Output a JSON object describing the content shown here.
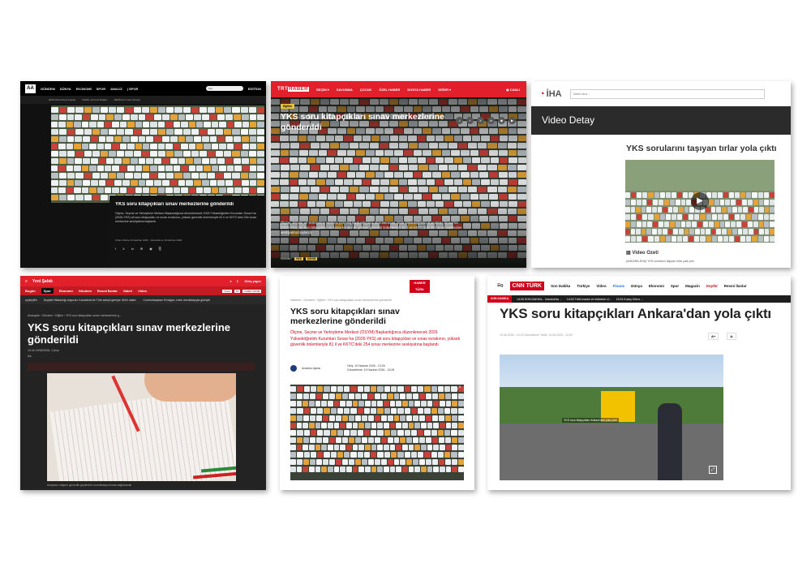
{
  "aa": {
    "logo": "AA",
    "nav": [
      "GÜNDEM",
      "DÜNYA",
      "EKONOMİ",
      "SPOR",
      "ANALİZ"
    ],
    "section": "| SPOR",
    "search_placeholder": "Ara",
    "edition": "EDİTİON",
    "ticker": [
      "2026 FIFA Dünya Kupası",
      "İSRAİL-Hürmüz Boğazı",
      "ABD/İran'ın Geri Sürüşü"
    ],
    "title": "YKS soru kitapçıkları sınav merkezlerine gönderildi",
    "summary": "Ölçme, Seçme ve Yerleştirme Merkezi Başkanlığınca düzenlenecek 2026 Yükseköğretim Kurumları Sınavı'na (2026-YKS) ait soru kitapçıkları ve sınav evrakının, yüksek güvenlik önlemleriyle 81 il ve KKTC'deki 254 sınav merkezine sevkiyatına başlandı.",
    "meta": "Ozlem Mente  19 Haziran 2026 · Güncelleme 19 Haziran 2026",
    "social": [
      "f",
      "X",
      "in",
      "✉",
      "◉",
      "⎘"
    ]
  },
  "trt": {
    "brand_a": "TRT",
    "brand_b": "HABER",
    "nav": [
      "SEÇİM ▾",
      "SAVUNMA",
      "ÇOCUK",
      "ÖZEL HABER",
      "DOSYA HABER",
      "DİĞER ▾"
    ],
    "live": "◉ CANLI",
    "tag": "Eğitim",
    "title": "YKS soru kitapçıkları sınav merkezlerine gönderildi",
    "social": [
      "♫",
      "f",
      "X",
      "in",
      "◉",
      "▶"
    ],
    "summary": "Ölçme, Seçme ve Yerleştirme Merkezi (ÖSYM) Başkanlığınca düzenlenecek 2026 Yükseköğretim Kurumları Sınavı'na (2026-YKS) ait soru kitapçıkları ve sınav evrakının, yüksek güvenlik önlemleriyle 81 il ve KKTC'deki 254 sınav merkezine sevkiyatına başlandı.",
    "tags_label": "Etiketler:",
    "tags": [
      "YKS",
      "ÖSYM"
    ]
  },
  "iha": {
    "logo_letter": "İHA",
    "video_search_placeholder": "Video Ara ...",
    "bar_title": "Video Detay",
    "title": "YKS sorularını taşıyan tırlar yola çıktı",
    "play": "▶",
    "summary_heading": "Video Özeti",
    "summary": "(ANKARA-DHA) YKS sorularını taşıyan tırlar yola çıktı"
  },
  "ys": {
    "logo": "Yeni Şafak",
    "header_right": [
      "⌕",
      "☾",
      "Giriş yapın"
    ],
    "nav": [
      "Bugün",
      "Spor",
      "Ekonomi",
      "Gündem",
      "Resmi İlanlar",
      "Galeri",
      "Video"
    ],
    "nav_active": 1,
    "nav_right": [
      "Yerel",
      "TV",
      "CANLI YAYIN"
    ],
    "ticker": [
      "çeyleyBN",
      "Dışişleri Bakanlığı duyurdu: Karadeniz'de Türk sahipli gemiye İHA'lı saldırı",
      "Cumhurbaşkanı Erdoğan, İranlı mevkidaşıyla görüştü"
    ],
    "breadcrumb": "Anasayfa  ›  Gündem  ›  Eğitim  ›  YKS soru kitapçıkları sınav merkezlerine g...",
    "title": "YKS soru kitapçıkları sınav merkezlerine gönderildi",
    "date": "10:44   19/06/2026, Cuma",
    "source": "AA",
    "image_caption": "Araçların ulaşımı güvenlik güçlerinin koordinasyonunda sağlanacak"
  },
  "ht": {
    "logo": "HABER TÜRK",
    "breadcrumb": "Haberler  ›  Gündem  ›  Eğitim  ›  YKS soru kitapçıkları sınav merkezlerine gönderildi",
    "title": "YKS soru kitapçıkları sınav merkezlerine gönderildi",
    "summary": "Ölçme, Seçme ve Yerleştirme Merkezi (ÖSYM) Başkanlığınca düzenlenecek 2026 Yükseköğretim Kurumları Sınavı'na (2026-YKS) ait soru kitapçıkları ve sınav evrakının, yüksek güvenlik önlemleriyle 81 il ve KKTC'deki 254 sınav merkezine sevkiyatına başlandı",
    "source": "Anadolu Ajansı",
    "entry": "Giriş: 19 Haziran 2026 - 13:26",
    "update": "Güncelleme: 19 Haziran 2026 - 13:28",
    "expand": "⤢"
  },
  "cnn": {
    "menu": "☰Q",
    "logo": "CNN TÜRK",
    "nav": [
      "Son Dakika",
      "Türkiye",
      "Video",
      "Finans",
      "Dünya",
      "Ekonomi",
      "Spor",
      "Magazin",
      "Keyfet",
      "Resmi İlanlar"
    ],
    "breaking_label": "SON DAKİKA",
    "breaking": [
      "14:05  SON DAKİKA... İstanbul'da ...",
      "14:03  Tıbbi maske ve eldivenle cl...",
      "13:34  Kuzey Kıbrıs ..."
    ],
    "title": "YKS soru kitapçıkları Ankara'dan yola çıktı",
    "info": "19.06.2026 - 10:13      Güncelleme Tarihi: 19.06.2026 - 10:53",
    "font_sizes": [
      "A+",
      "A-"
    ],
    "image_caption": "YKS soru kitapçıkları Ankara'dan yola çıktı",
    "expand": "⤢"
  }
}
